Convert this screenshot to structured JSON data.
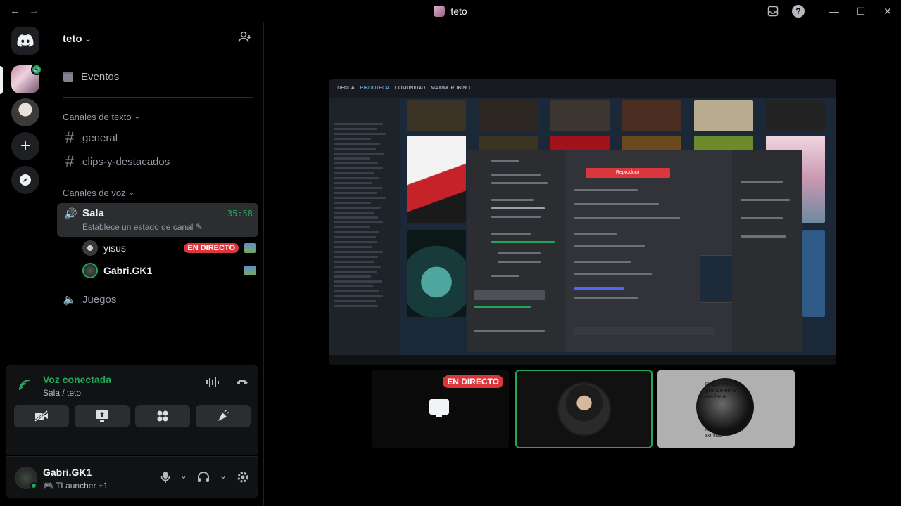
{
  "window": {
    "title": "teto",
    "back_icon": "←",
    "forward_icon": "→",
    "inbox_icon": "inbox-icon",
    "help_icon": "?",
    "minimize": "—",
    "maximize": "☐",
    "close": "✕"
  },
  "server": {
    "name": "teto",
    "events_label": "Eventos",
    "text_category": "Canales de texto",
    "text_channels": [
      "general",
      "clips-y-destacados"
    ],
    "voice_category": "Canales de voz",
    "voice_channel": {
      "name": "Sala",
      "status": "Establece un estado de canal",
      "timer": "35:58"
    },
    "voice_users": [
      {
        "name": "yisus",
        "badge": "EN DIRECTO"
      },
      {
        "name": "Gabri.GK1"
      }
    ],
    "other_voice_channel": "Juegos"
  },
  "voice_connection": {
    "title": "Voz conectada",
    "subtitle": "Sala / teto"
  },
  "user": {
    "name": "Gabri.GK1",
    "status": "TLauncher",
    "status_extra": "+1"
  },
  "stage": {
    "shared_nav": [
      "TIENDA",
      "BIBLIOTECA",
      "COMUNIDAD",
      "MAXIMORUBINO"
    ],
    "shared_overlay_button": "Reproducir",
    "tile_live_badge": "EN DIRECTO",
    "tile3_text_top": "lo que ves es grande en la mañana",
    "tile3_text_bottom": "reportence con sonido"
  },
  "colors": {
    "accent_green": "#23a55a",
    "live_red": "#da373c",
    "background": "#000000",
    "panel": "#2b2d31"
  }
}
